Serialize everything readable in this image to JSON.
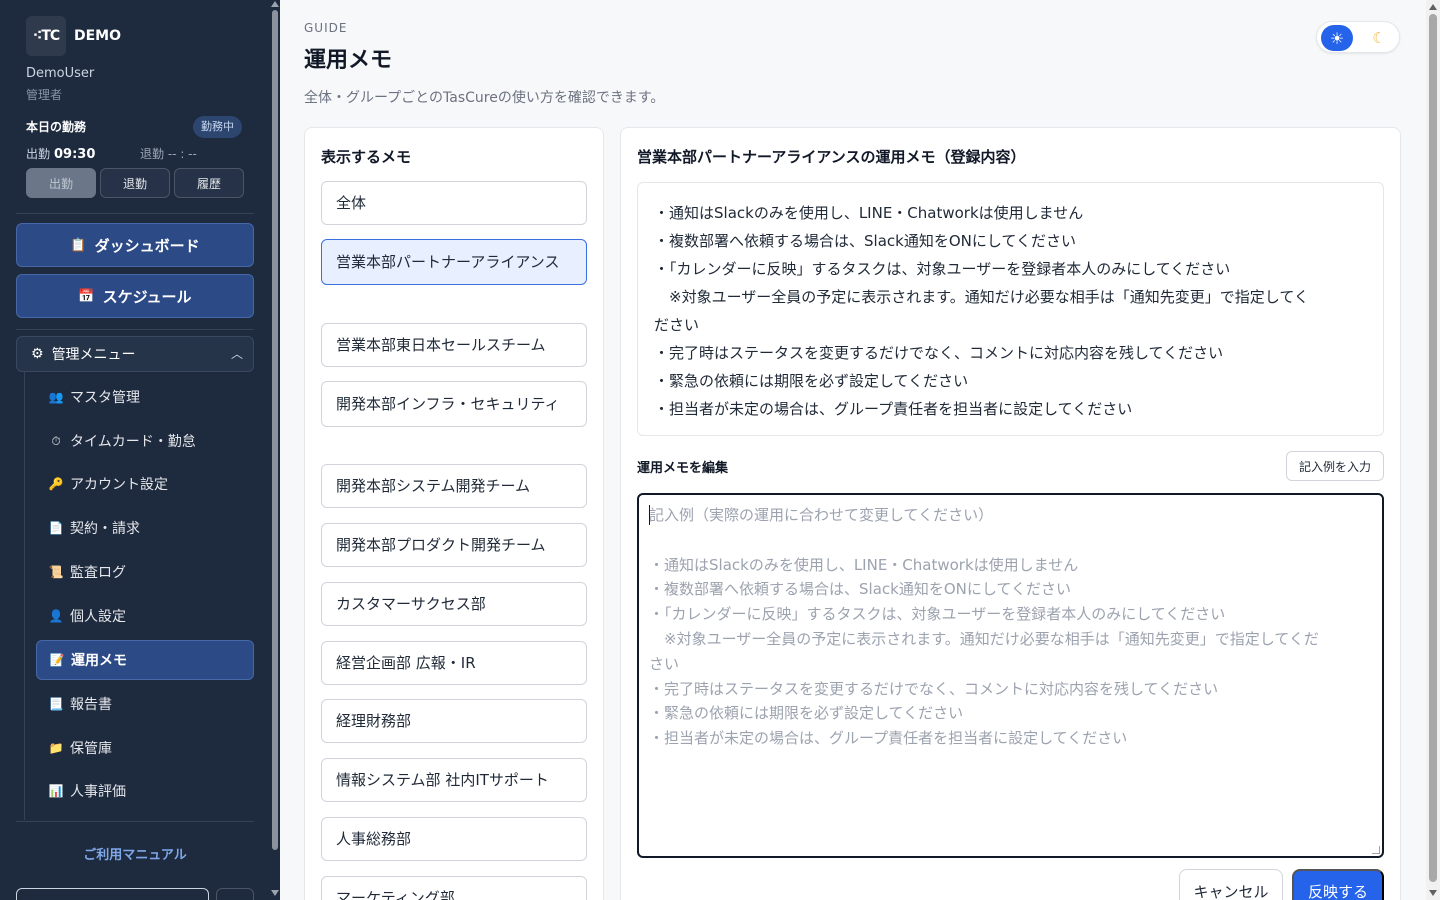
{
  "sidebar": {
    "brand": {
      "logo_text": "⁖TC",
      "name": "DEMO"
    },
    "user": {
      "name": "DemoUser",
      "role": "管理者"
    },
    "attendance": {
      "title": "本日の勤務",
      "status_badge": "勤務中",
      "clock_in_label": "出勤",
      "clock_in_time": "09:30",
      "clock_out_label": "退勤",
      "clock_out_time": "-- : --",
      "buttons": [
        "出勤",
        "退勤",
        "履歴"
      ]
    },
    "main_nav": [
      {
        "label": "ダッシュボード",
        "icon": "clipboard-icon"
      },
      {
        "label": "スケジュール",
        "icon": "calendar-icon"
      }
    ],
    "admin_menu": {
      "label": "管理メニュー",
      "icon": "gear-icon",
      "expanded": true,
      "items": [
        {
          "label": "マスタ管理",
          "icon": "users-icon",
          "glyph": "👥"
        },
        {
          "label": "タイムカード・勤怠",
          "icon": "stopwatch-icon",
          "glyph": "⏱"
        },
        {
          "label": "アカウント設定",
          "icon": "key-icon",
          "glyph": "🔑"
        },
        {
          "label": "契約・請求",
          "icon": "document-icon",
          "glyph": "📄"
        },
        {
          "label": "監査ログ",
          "icon": "scroll-icon",
          "glyph": "📜"
        },
        {
          "label": "個人設定",
          "icon": "person-icon",
          "glyph": "👤"
        },
        {
          "label": "運用メモ",
          "icon": "memo-icon",
          "glyph": "📝",
          "active": true
        },
        {
          "label": "報告書",
          "icon": "page-icon",
          "glyph": "📃"
        },
        {
          "label": "保管庫",
          "icon": "folder-icon",
          "glyph": "📁"
        },
        {
          "label": "人事評価",
          "icon": "bar-chart-icon",
          "glyph": "📊"
        }
      ]
    },
    "manual_link": "ご利用マニュアル"
  },
  "header": {
    "eyebrow": "GUIDE",
    "title": "運用メモ",
    "description": "全体・グループごとのTasCureの使い方を確認できます。",
    "theme": {
      "light_icon": "sun-icon",
      "dark_icon": "moon-icon",
      "selected": "light"
    }
  },
  "memo_list": {
    "title": "表示するメモ",
    "items": [
      "全体",
      "営業本部パートナーアライアンス",
      "営業本部東日本セールスチーム",
      "開発本部インフラ・セキュリティ",
      "開発本部システム開発チーム",
      "開発本部プロダクト開発チーム",
      "カスタマーサクセス部",
      "経営企画部 広報・IR",
      "経理財務部",
      "情報システム部 社内ITサポート",
      "人事総務部",
      "マーケティング部"
    ],
    "selected_index": 1
  },
  "memo_detail": {
    "title": "営業本部パートナーアライアンスの運用メモ（登録内容）",
    "lines": [
      "・通知はSlackのみを使用し、LINE・Chatworkは使用しません",
      "・複数部署へ依頼する場合は、Slack通知をONにしてください",
      "・「カレンダーに反映」するタスクは、対象ユーザーを登録者本人のみにしてください",
      "　※対象ユーザー全員の予定に表示されます。通知だけ必要な相手は「通知先変更」で指定してく",
      "ださい",
      "・完了時はステータスを変更するだけでなく、コメントに対応内容を残してください",
      "・緊急の依頼には期限を必ず設定してください",
      "・担当者が未定の場合は、グループ責任者を担当者に設定してください"
    ]
  },
  "editor": {
    "label": "運用メモを編集",
    "example_button": "記入例を入力",
    "value": "",
    "placeholder_lines": [
      "記入例（実際の運用に合わせて変更してください）",
      "",
      "・通知はSlackのみを使用し、LINE・Chatworkは使用しません",
      "・複数部署へ依頼する場合は、Slack通知をONにしてください",
      "・「カレンダーに反映」するタスクは、対象ユーザーを登録者本人のみにしてください",
      "　※対象ユーザー全員の予定に表示されます。通知だけ必要な相手は「通知先変更」で指定してくだ",
      "さい",
      "・完了時はステータスを変更するだけでなく、コメントに対応内容を残してください",
      "・緊急の依頼には期限を必ず設定してください",
      "・担当者が未定の場合は、グループ責任者を担当者に設定してください"
    ],
    "cancel_button": "キャンセル",
    "apply_button": "反映する"
  },
  "colors": {
    "sidebar_bg": "#1e2a3e",
    "nav_active": "#2c4a86",
    "accent": "#2563eb",
    "selected_item_bg": "#e8efff"
  }
}
